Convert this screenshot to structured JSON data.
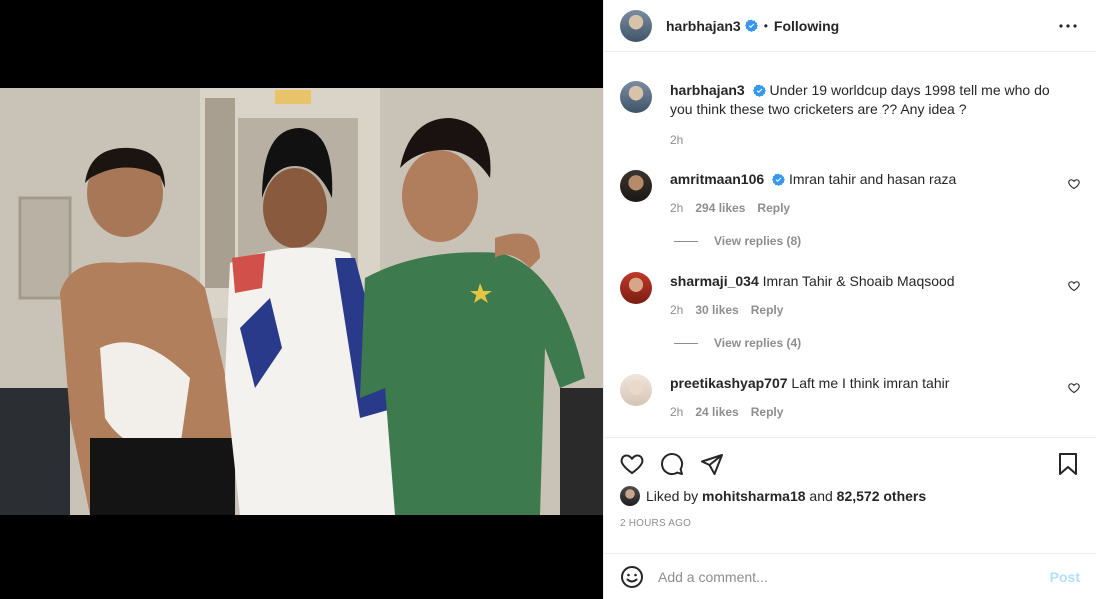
{
  "header": {
    "username": "harbhajan3",
    "dot": "•",
    "follow_status": "Following"
  },
  "caption": {
    "username": "harbhajan3",
    "text": "Under 19 worldcup days 1998 tell me who do you think these two cricketers are ?? Any idea ?",
    "time": "2h"
  },
  "comments": [
    {
      "username": "amritmaan106",
      "verified": true,
      "text": "Imran tahir and hasan raza",
      "time": "2h",
      "likes": "294 likes",
      "reply": "Reply",
      "view_replies": "View replies (8)"
    },
    {
      "username": "sharmaji_034",
      "verified": false,
      "text": "Imran Tahir & Shoaib Maqsood",
      "time": "2h",
      "likes": "30 likes",
      "reply": "Reply",
      "view_replies": "View replies (4)"
    },
    {
      "username": "preetikashyap707",
      "verified": false,
      "text": "Laft me I think imran tahir",
      "time": "2h",
      "likes": "24 likes",
      "reply": "Reply"
    }
  ],
  "likes": {
    "prefix": "Liked by",
    "user": "mohitsharma18",
    "middle": "and",
    "others": "82,572 others"
  },
  "timestamp": "2 HOURS AGO",
  "add_comment": {
    "placeholder": "Add a comment...",
    "post_label": "Post"
  },
  "colors": {
    "verified": "#3897f0",
    "text": "#262626",
    "muted": "#8e8e8e",
    "post_disabled": "#b2dffc"
  }
}
